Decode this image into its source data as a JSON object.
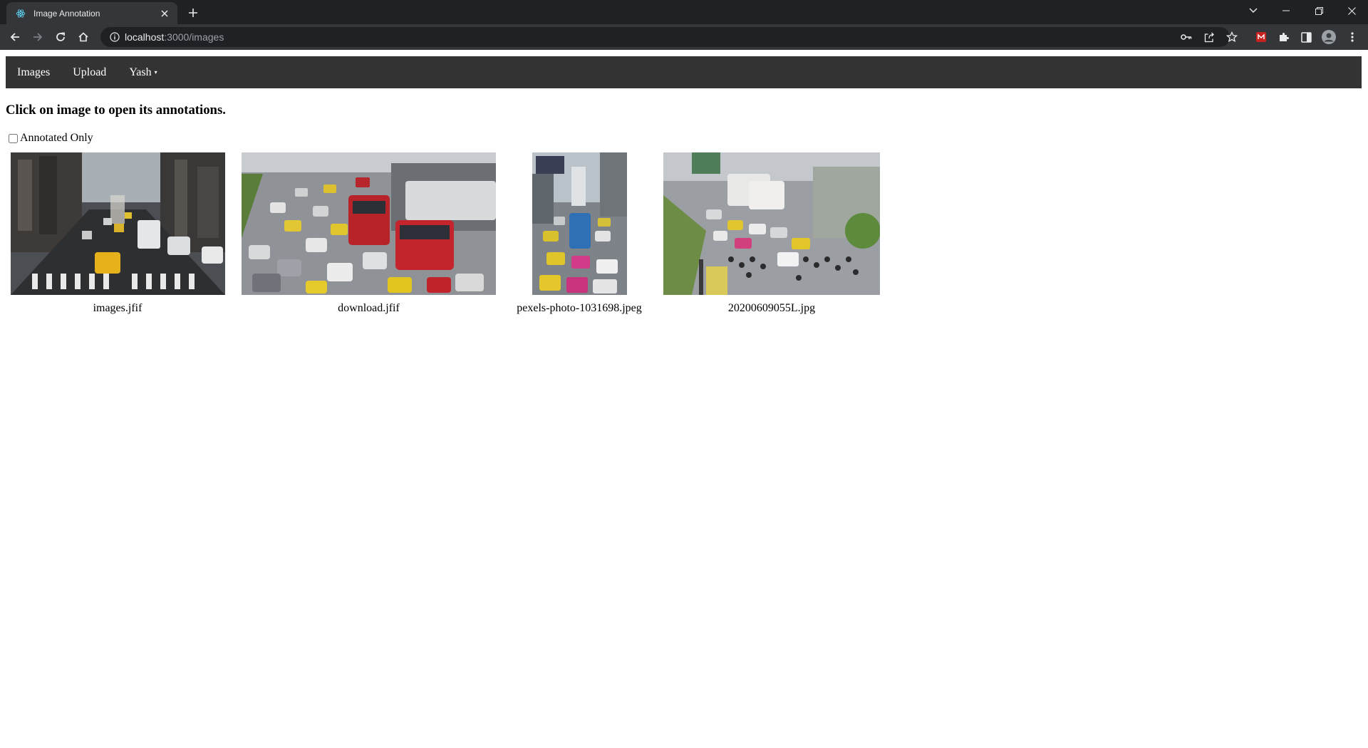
{
  "browser": {
    "tab_title": "Image Annotation",
    "url_host": "localhost",
    "url_path": ":3000/images"
  },
  "navbar": {
    "images_label": "Images",
    "upload_label": "Upload",
    "user_label": "Yash"
  },
  "page": {
    "instructions": "Click on image to open its annotations.",
    "filter_label": "Annotated Only",
    "filter_checked": false
  },
  "images": [
    {
      "filename": "images.jfif",
      "scene": "city avenue traffic with yellow taxi at crosswalk"
    },
    {
      "filename": "download.jfif",
      "scene": "dense highway traffic with red buses"
    },
    {
      "filename": "pexels-photo-1031698.jpeg",
      "scene": "congested city street with taxis, portrait"
    },
    {
      "filename": "20200609055L.jpg",
      "scene": "traffic with buses and motorbikes"
    }
  ]
}
